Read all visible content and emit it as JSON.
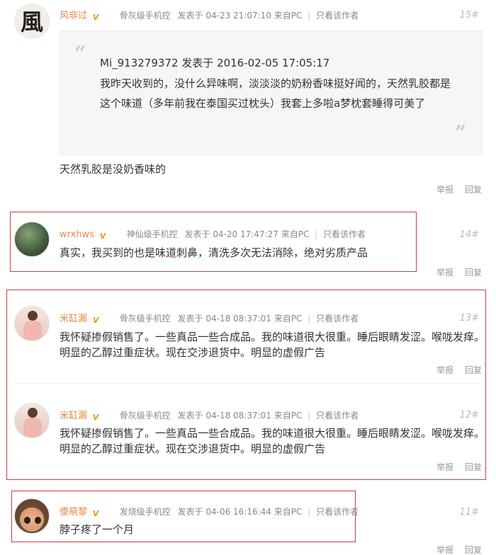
{
  "posts": [
    {
      "user": "风非过",
      "level": "骨灰级手机控",
      "posted_prefix": "发表于",
      "time": "04-23 21:07:10",
      "source": "来自PC",
      "only_author": "只看该作者",
      "floor": "15#",
      "avatar_char": "風",
      "quote": {
        "author_line": "Mi_913279372 发表于 2016-02-05 17:05:17",
        "text": "我昨天收到的，没什么异味啊，淡淡淡的奶粉香味挺好闻的，天然乳胶都是这个味道（多年前我在泰国买过枕头）我套上多啦a梦枕套睡得可美了"
      },
      "content": "天然乳胶是没奶香味的",
      "report": "举报",
      "reply": "回复"
    },
    {
      "user": "wrxhws",
      "level": "神仙级手机控",
      "posted_prefix": "发表于",
      "time": "04-20 17:47:27",
      "source": "来自PC",
      "only_author": "只看该作者",
      "floor": "14#",
      "content": "真实，我买到的也是味道刺鼻，清洗多次无法消除，绝对劣质产品",
      "report": "举报",
      "reply": "回复"
    },
    {
      "user": "米缸漏",
      "level": "骨灰级手机控",
      "posted_prefix": "发表于",
      "time": "04-18 08:37:01",
      "source": "来自PC",
      "only_author": "只看该作者",
      "floor": "13#",
      "content": "我怀疑掺假销售了。一些真品一些合成品。我的味道很大很重。睡后眼睛发涩。喉咙发痒。明显的乙醇过重症状。现在交涉退货中。明显的虚假广告",
      "report": "举报",
      "reply": "回复"
    },
    {
      "user": "米缸漏",
      "level": "骨灰级手机控",
      "posted_prefix": "发表于",
      "time": "04-18 08:37:01",
      "source": "来自PC",
      "only_author": "只看该作者",
      "floor": "12#",
      "content": "我怀疑掺假销售了。一些真品一些合成品。我的味道很大很重。睡后眼睛发涩。喉咙发痒。明显的乙醇过重症状。现在交涉退货中。明显的虚假广告",
      "report": "举报",
      "reply": "回复"
    },
    {
      "user": "傻萌黎",
      "level": "发烧级手机控",
      "posted_prefix": "发表于",
      "time": "04-06 16:16:44",
      "source": "来自PC",
      "only_author": "只看该作者",
      "floor": "11#",
      "content": "脖子疼了一个月",
      "report": "举报",
      "reply": "回复"
    }
  ],
  "badge_label": "V",
  "colors": {
    "username": "#e6884a",
    "highlight_border": "#d33a3a",
    "quote_bg": "#f6f6f6"
  }
}
